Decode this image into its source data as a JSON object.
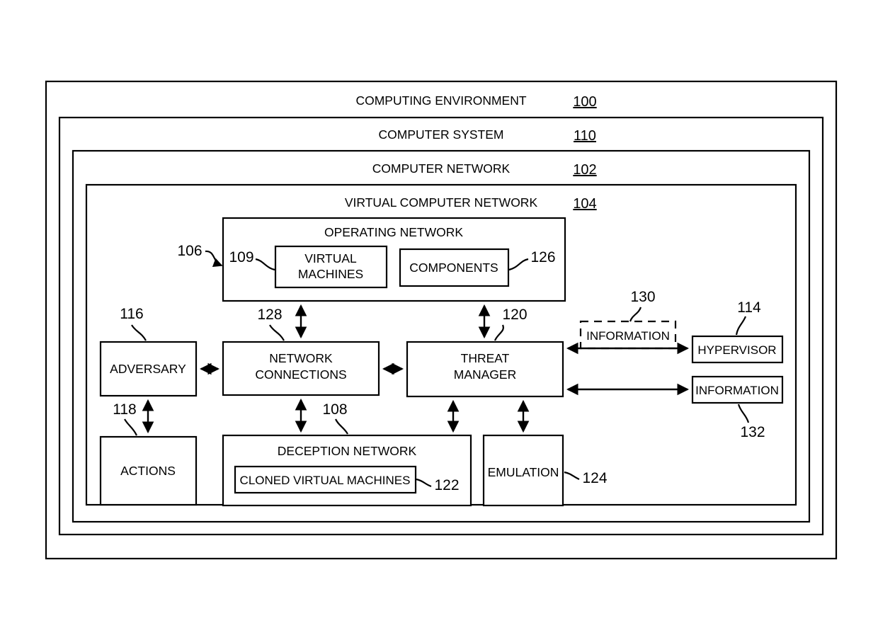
{
  "figure": {
    "nested_frames": [
      {
        "title": "COMPUTING ENVIRONMENT",
        "ref": "100"
      },
      {
        "title": "COMPUTER SYSTEM",
        "ref": "110"
      },
      {
        "title": "COMPUTER NETWORK",
        "ref": "102"
      },
      {
        "title": "VIRTUAL COMPUTER NETWORK",
        "ref": "104"
      }
    ],
    "operating_network": {
      "title": "OPERATING NETWORK",
      "ref": "106",
      "children": [
        {
          "label_line1": "VIRTUAL",
          "label_line2": "MACHINES",
          "ref": "109"
        },
        {
          "label_line1": "COMPONENTS",
          "label_line2": "",
          "ref": "126"
        }
      ]
    },
    "blocks": {
      "adversary": {
        "label": "ADVERSARY",
        "ref": "116"
      },
      "actions": {
        "label": "ACTIONS",
        "ref": "118"
      },
      "network_connections": {
        "label_line1": "NETWORK",
        "label_line2": "CONNECTIONS",
        "ref": "128"
      },
      "threat_manager": {
        "label_line1": "THREAT",
        "label_line2": "MANAGER",
        "ref": "120"
      },
      "deception_network": {
        "title": "DECEPTION NETWORK",
        "ref": "108"
      },
      "cloned_virtual_machines": {
        "label": "CLONED VIRTUAL MACHINES",
        "ref": "122"
      },
      "emulation": {
        "label": "EMULATION",
        "ref": "124"
      },
      "information_dashed": {
        "label": "INFORMATION",
        "ref": "130"
      },
      "hypervisor": {
        "label": "HYPERVISOR",
        "ref": "114"
      },
      "information_solid": {
        "label": "INFORMATION",
        "ref": "132"
      }
    },
    "colors": {
      "line": "#000000",
      "background": "#ffffff"
    }
  }
}
